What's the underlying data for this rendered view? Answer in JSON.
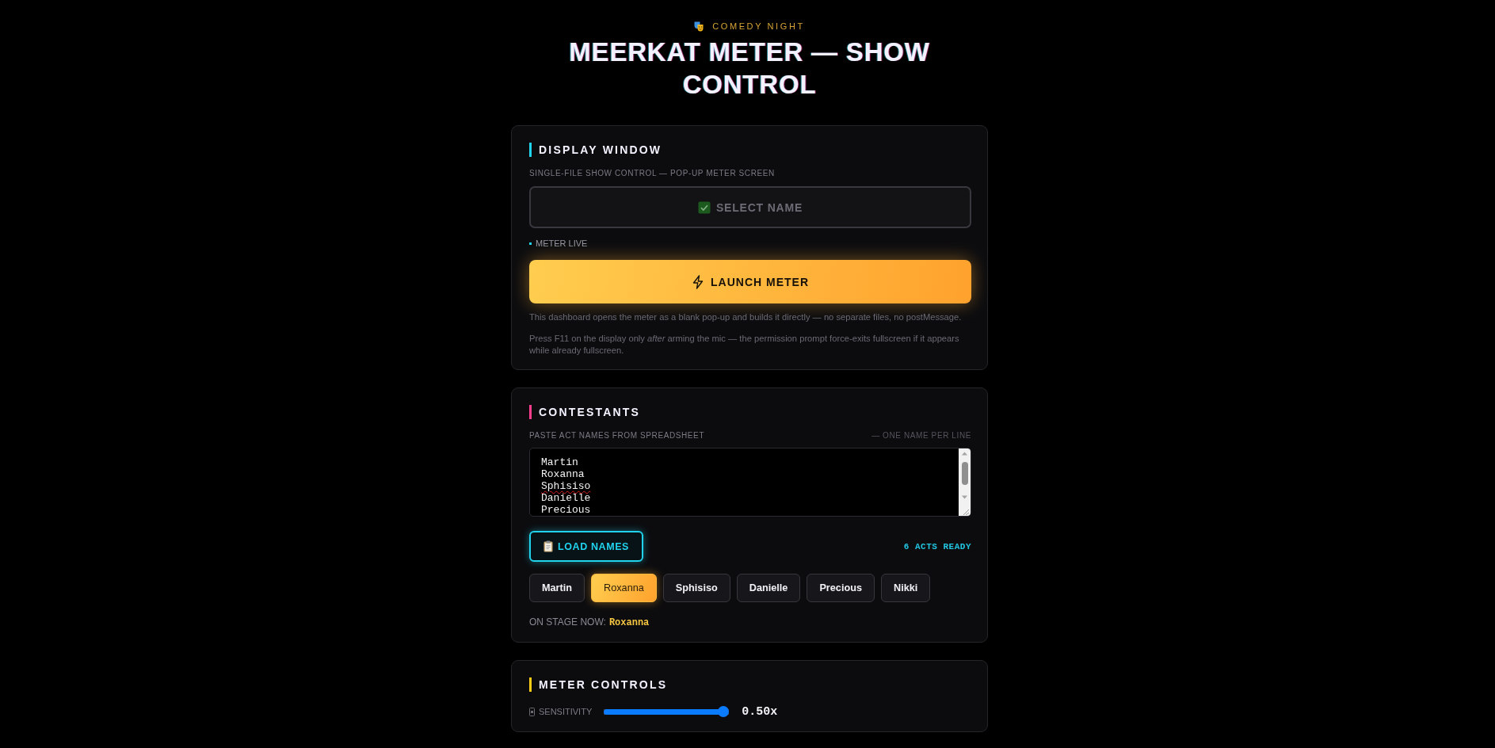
{
  "header": {
    "eyebrow": "COMEDY NIGHT",
    "title": "MEERKAT METER — SHOW CONTROL"
  },
  "display_window": {
    "heading": "DISPLAY WINDOW",
    "subtitle": "SINGLE-FILE SHOW CONTROL — POP-UP METER SCREEN",
    "select_button": {
      "label": "SELECT NAME",
      "disabled": true
    },
    "status": "METER LIVE",
    "launch_button": "LAUNCH METER",
    "notes": [
      "This dashboard opens the meter as a blank pop-up and builds it directly — no separate files, no postMessage.",
      "Press F11 on the display only *after* arming the mic — the permission prompt force-exits fullscreen if it appears while already fullscreen."
    ]
  },
  "contestants": {
    "heading": "CONTESTANTS",
    "label": "PASTE ACT NAMES FROM SPREADSHEET",
    "hint": "— ONE NAME PER LINE",
    "textarea": {
      "lines": [
        {
          "text": "Martin",
          "misspelled": false
        },
        {
          "text": "Roxanna",
          "misspelled": false
        },
        {
          "text": "Sphisiso",
          "misspelled": true
        },
        {
          "text": "Danielle",
          "misspelled": false
        },
        {
          "text": "Precious",
          "misspelled": false
        }
      ]
    },
    "load_button": "LOAD NAMES",
    "count": "6 ACTS READY",
    "chips": [
      {
        "label": "Martin",
        "selected": false
      },
      {
        "label": "Roxanna",
        "selected": true
      },
      {
        "label": "Sphisiso",
        "selected": false
      },
      {
        "label": "Danielle",
        "selected": false
      },
      {
        "label": "Precious",
        "selected": false
      },
      {
        "label": "Nikki",
        "selected": false
      }
    ],
    "on_stage": {
      "label": "ON STAGE NOW:",
      "name": "Roxanna"
    }
  },
  "meter_controls": {
    "heading": "METER CONTROLS",
    "sliders": [
      {
        "label": "SENSITIVITY",
        "level": 1,
        "reading": "0.50x"
      }
    ]
  }
}
